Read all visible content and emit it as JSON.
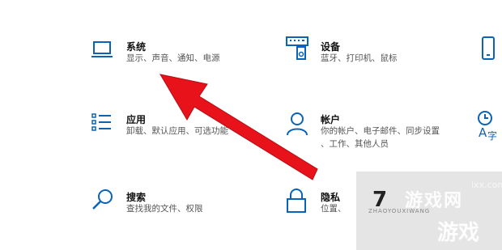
{
  "tiles": {
    "system": {
      "title": "系统",
      "desc": "显示、声音、通知、电源",
      "icon": "laptop-icon"
    },
    "devices": {
      "title": "设备",
      "desc": "蓝牙、打印机、鼠标",
      "icon": "keyboard-speaker-icon"
    },
    "phone": {
      "icon": "phone-icon"
    },
    "apps": {
      "title": "应用",
      "desc": "卸载、默认应用、可选功能",
      "icon": "apps-list-icon"
    },
    "accounts": {
      "title": "帐户",
      "desc_line1": "你的帐户、电子邮件、同步设置",
      "desc_line2": "、工作、其他人员",
      "icon": "person-icon"
    },
    "time_language": {
      "icon": "time-language-icon"
    },
    "search": {
      "title": "搜索",
      "desc": "查找我的文件、权限",
      "icon": "search-icon"
    },
    "privacy": {
      "title": "隐私",
      "desc": "位置、",
      "icon": "lock-icon"
    }
  },
  "watermark": {
    "title": "游戏网",
    "sub": "ZHAOYOUXIWANG",
    "big": "游戏",
    "site": "ixx.com",
    "digit": "7"
  },
  "colors": {
    "accent": "#0a63b8",
    "arrow": "#e8121b"
  }
}
